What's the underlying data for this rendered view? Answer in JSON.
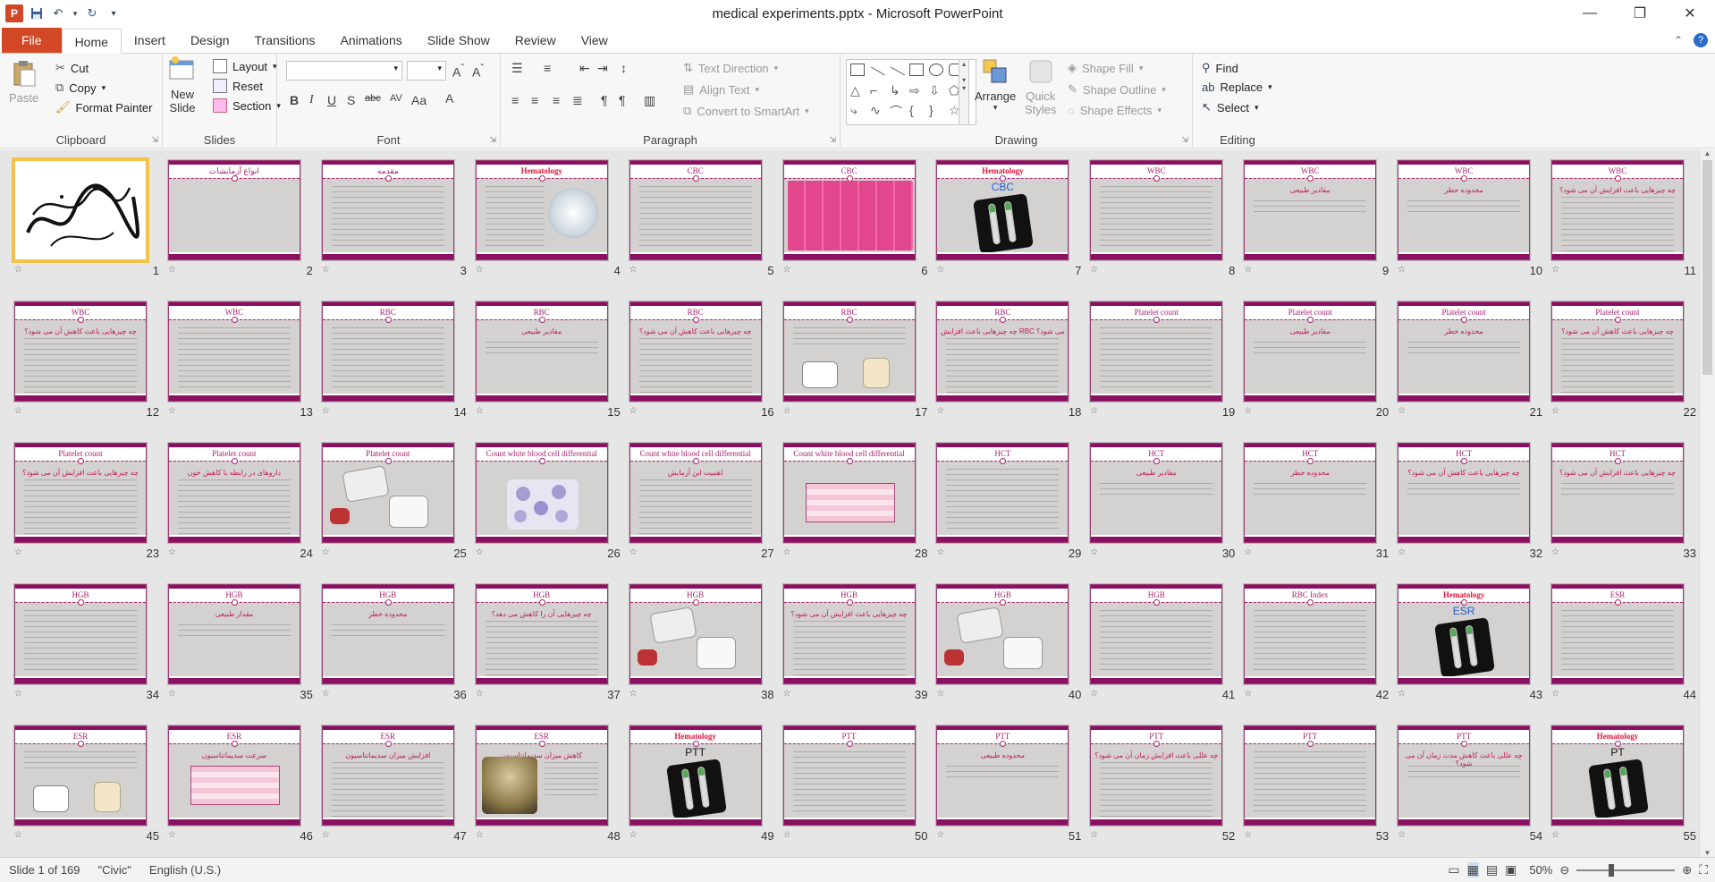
{
  "window": {
    "title": "medical experiments.pptx - Microsoft PowerPoint",
    "app_icon": "P",
    "controls": [
      "minimize-icon",
      "restore-icon",
      "close-icon"
    ]
  },
  "tabs": [
    {
      "label": "File"
    },
    {
      "label": "Home"
    },
    {
      "label": "Insert"
    },
    {
      "label": "Design"
    },
    {
      "label": "Transitions"
    },
    {
      "label": "Animations"
    },
    {
      "label": "Slide Show"
    },
    {
      "label": "Review"
    },
    {
      "label": "View"
    }
  ],
  "ribbon": {
    "clipboard": {
      "label": "Clipboard",
      "paste": "Paste",
      "cut": "Cut",
      "copy": "Copy",
      "format_painter": "Format Painter"
    },
    "slides": {
      "label": "Slides",
      "new_slide_1": "New",
      "new_slide_2": "Slide",
      "layout": "Layout",
      "reset": "Reset",
      "section": "Section"
    },
    "font": {
      "label": "Font",
      "font_name": "",
      "font_size": ""
    },
    "paragraph": {
      "label": "Paragraph",
      "text_direction": "Text Direction",
      "align_text": "Align Text",
      "convert_smartart": "Convert to SmartArt"
    },
    "drawing": {
      "label": "Drawing",
      "arrange": "Arrange",
      "quick_styles_1": "Quick",
      "quick_styles_2": "Styles",
      "shape_fill": "Shape Fill",
      "shape_outline": "Shape Outline",
      "shape_effects": "Shape Effects"
    },
    "editing": {
      "label": "Editing",
      "find": "Find",
      "replace": "Replace",
      "select": "Select"
    }
  },
  "slides": [
    {
      "n": "1",
      "title": "",
      "kind": "calligraphy",
      "selected": true
    },
    {
      "n": "2",
      "title": "انواع آزمایشات",
      "kind": "title-only"
    },
    {
      "n": "3",
      "title": "مقدمه",
      "kind": "text"
    },
    {
      "n": "4",
      "title": "Hematology",
      "kind": "list-pic",
      "red": true
    },
    {
      "n": "5",
      "title": "CBC",
      "kind": "text"
    },
    {
      "n": "6",
      "title": "CBC",
      "kind": "pink-graphic"
    },
    {
      "n": "7",
      "title": "Hematology",
      "sub": "CBC",
      "kind": "tubes",
      "red": true
    },
    {
      "n": "8",
      "title": "WBC",
      "kind": "text"
    },
    {
      "n": "9",
      "title": "WBC",
      "sub": "مقادیر طبیعی",
      "kind": "text-short"
    },
    {
      "n": "10",
      "title": "WBC",
      "sub": "محدوده خطر",
      "kind": "text-short"
    },
    {
      "n": "11",
      "title": "WBC",
      "sub": "چه چیزهایی باعث افزایش آن می شود؟",
      "kind": "text"
    },
    {
      "n": "12",
      "title": "WBC",
      "sub": "چه چیزهایی باعث کاهش آن می شود؟",
      "kind": "text"
    },
    {
      "n": "13",
      "title": "WBC",
      "kind": "text"
    },
    {
      "n": "14",
      "title": "RBC",
      "kind": "text"
    },
    {
      "n": "15",
      "title": "RBC",
      "sub": "مقادیر طبیعی",
      "kind": "text-short"
    },
    {
      "n": "16",
      "title": "RBC",
      "sub": "چه چیزهایی باعث کاهش آن می شود؟",
      "kind": "text"
    },
    {
      "n": "17",
      "title": "RBC",
      "kind": "text-pics"
    },
    {
      "n": "18",
      "title": "RBC",
      "sub": "چه چیزهایی باعث افزایش RBC می شود؟",
      "kind": "text"
    },
    {
      "n": "19",
      "title": "Platelet count",
      "kind": "text"
    },
    {
      "n": "20",
      "title": "Platelet count",
      "sub": "مقادیر طبیعی",
      "kind": "text-short"
    },
    {
      "n": "21",
      "title": "Platelet count",
      "sub": "محدوده خطر",
      "kind": "text-short"
    },
    {
      "n": "22",
      "title": "Platelet count",
      "sub": "چه چیزهایی باعث کاهش آن می شود؟",
      "kind": "text"
    },
    {
      "n": "23",
      "title": "Platelet count",
      "sub": "چه چیزهایی باعث افزایش آن می شود؟",
      "kind": "text"
    },
    {
      "n": "24",
      "title": "Platelet count",
      "sub": "داروهای در رابطه با کاهش خون",
      "kind": "text"
    },
    {
      "n": "25",
      "title": "Platelet count",
      "kind": "pics"
    },
    {
      "n": "26",
      "title": "Count white blood cell differential",
      "kind": "cells"
    },
    {
      "n": "27",
      "title": "Count white blood cell differential",
      "sub": "اهمیت این آزمایش",
      "kind": "text"
    },
    {
      "n": "28",
      "title": "Count white blood cell differential",
      "kind": "table"
    },
    {
      "n": "29",
      "title": "HCT",
      "kind": "text"
    },
    {
      "n": "30",
      "title": "HCT",
      "sub": "مقادیر طبیعی",
      "kind": "text-short"
    },
    {
      "n": "31",
      "title": "HCT",
      "sub": "محدوده خطر",
      "kind": "text-short"
    },
    {
      "n": "32",
      "title": "HCT",
      "sub": "چه چیزهایی باعث کاهش آن می شود؟",
      "kind": "text-short"
    },
    {
      "n": "33",
      "title": "HCT",
      "sub": "چه چیزهایی باعث افزایش آن می شود؟",
      "kind": "text-short"
    },
    {
      "n": "34",
      "title": "HGB",
      "kind": "text"
    },
    {
      "n": "35",
      "title": "HGB",
      "sub": "مقدار طبیعی",
      "kind": "text-short"
    },
    {
      "n": "36",
      "title": "HGB",
      "sub": "محدوده خطر",
      "kind": "text-short"
    },
    {
      "n": "37",
      "title": "HGB",
      "sub": "چه چیزهایی آن را کاهش می دهد؟",
      "kind": "text"
    },
    {
      "n": "38",
      "title": "HGB",
      "kind": "pics"
    },
    {
      "n": "39",
      "title": "HGB",
      "sub": "چه چیزهایی باعث افزایش آن می شود؟",
      "kind": "text"
    },
    {
      "n": "40",
      "title": "HGB",
      "kind": "pics"
    },
    {
      "n": "41",
      "title": "HGB",
      "kind": "text"
    },
    {
      "n": "42",
      "title": "RBC Index",
      "kind": "text"
    },
    {
      "n": "43",
      "title": "Hematology",
      "sub": "ESR",
      "kind": "tubes",
      "red": true
    },
    {
      "n": "44",
      "title": "ESR",
      "kind": "text"
    },
    {
      "n": "45",
      "title": "ESR",
      "kind": "text-pics"
    },
    {
      "n": "46",
      "title": "ESR",
      "sub": "سرعت سدیمانتاسیون",
      "kind": "table"
    },
    {
      "n": "47",
      "title": "ESR",
      "sub": "افزایش میزان سدیمانتاسیون",
      "kind": "text"
    },
    {
      "n": "48",
      "title": "ESR",
      "sub": "کاهش میزان سدیمانتاسیون",
      "kind": "statue"
    },
    {
      "n": "49",
      "title": "Hematology",
      "sub": "PTT",
      "kind": "tubes",
      "red": true
    },
    {
      "n": "50",
      "title": "PTT",
      "kind": "text"
    },
    {
      "n": "51",
      "title": "PTT",
      "sub": "محدوده طبیعی",
      "kind": "text-short"
    },
    {
      "n": "52",
      "title": "PTT",
      "sub": "چه عللی باعث افزایش زمان آن می شود؟",
      "kind": "text"
    },
    {
      "n": "53",
      "title": "PTT",
      "kind": "text"
    },
    {
      "n": "54",
      "title": "PTT",
      "sub": "چه عللی باعث کاهش مدت زمان آن می شود؟",
      "kind": "text-short"
    },
    {
      "n": "55",
      "title": "Hematology",
      "sub": "PT",
      "kind": "tubes",
      "red": true
    }
  ],
  "status": {
    "slide_info": "Slide 1 of 169",
    "theme": "\"Civic\"",
    "language": "English (U.S.)",
    "zoom": "50%"
  }
}
